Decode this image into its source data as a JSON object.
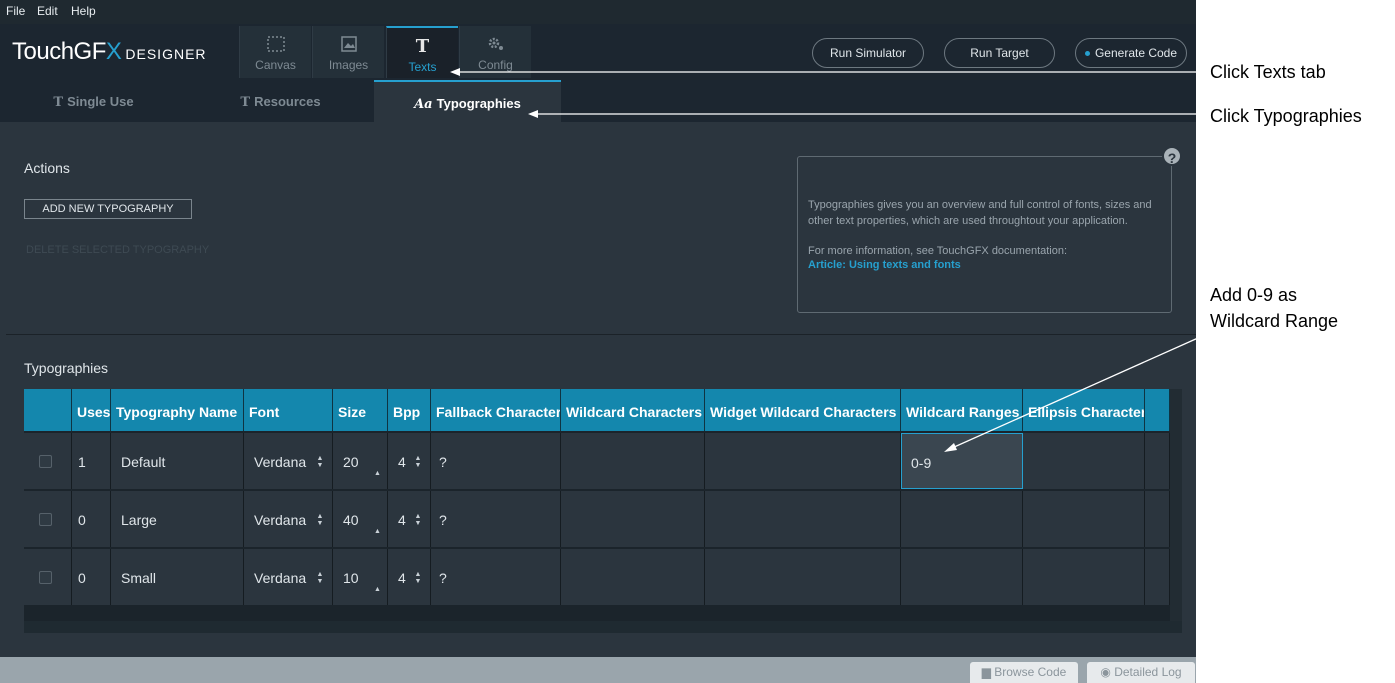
{
  "menu": [
    "File",
    "Edit",
    "Help"
  ],
  "logo": {
    "touch": "Touch",
    "gf": "GF",
    "x": "X",
    "designer": "DESIGNER"
  },
  "nav_tabs": [
    {
      "label": "Canvas",
      "icon": "canvas-icon"
    },
    {
      "label": "Images",
      "icon": "image-icon"
    },
    {
      "label": "Texts",
      "icon": "text-icon",
      "glyph": "T"
    },
    {
      "label": "Config",
      "icon": "gear-icon"
    }
  ],
  "header_buttons": {
    "run_simulator": "Run Simulator",
    "run_target": "Run Target",
    "generate_code": "Generate Code"
  },
  "sub_tabs": [
    {
      "label": "Single Use",
      "glyph": "T"
    },
    {
      "label": "Resources",
      "glyph": "T"
    },
    {
      "label": "Typographies",
      "glyph": "Aa"
    }
  ],
  "actions": {
    "title": "Actions",
    "add_button": "ADD NEW TYPOGRAPHY",
    "disabled_action": "DELETE SELECTED TYPOGRAPHY"
  },
  "info": {
    "text": "Typographies gives you an overview and full control of fonts, sizes and other text properties, which are used throughtout your application.",
    "more": "For more information, see TouchGFX documentation:",
    "link": "Article: Using texts and fonts",
    "help": "?"
  },
  "table": {
    "title": "Typographies",
    "columns": [
      "Uses",
      "Typography Name",
      "Font",
      "Size",
      "Bpp",
      "Fallback Character",
      "Wildcard Characters",
      "Widget Wildcard Characters",
      "Wildcard Ranges",
      "Ellipsis Character"
    ],
    "rows": [
      {
        "uses": "1",
        "name": "Default",
        "font": "Verdana",
        "size": "20",
        "bpp": "4",
        "fallback": "?",
        "wildcard_chars": "",
        "widget_wildcard": "",
        "wildcard_ranges": "0-9",
        "ellipsis": ""
      },
      {
        "uses": "0",
        "name": "Large",
        "font": "Verdana",
        "size": "40",
        "bpp": "4",
        "fallback": "?",
        "wildcard_chars": "",
        "widget_wildcard": "",
        "wildcard_ranges": "",
        "ellipsis": ""
      },
      {
        "uses": "0",
        "name": "Small",
        "font": "Verdana",
        "size": "10",
        "bpp": "4",
        "fallback": "?",
        "wildcard_chars": "",
        "widget_wildcard": "",
        "wildcard_ranges": "",
        "ellipsis": ""
      }
    ]
  },
  "footer": {
    "browse_code": "Browse Code",
    "detailed_log": "Detailed Log"
  },
  "annotations": {
    "texts_tab": "Click Texts tab",
    "typographies": "Click Typographies",
    "wildcard_line1": "Add 0-9 as",
    "wildcard_line2": "Wildcard Range"
  },
  "colors": {
    "accent": "#26a0cf",
    "header_bg": "#1c2630",
    "panel_bg": "#2b353e",
    "table_header": "#1487ad"
  }
}
